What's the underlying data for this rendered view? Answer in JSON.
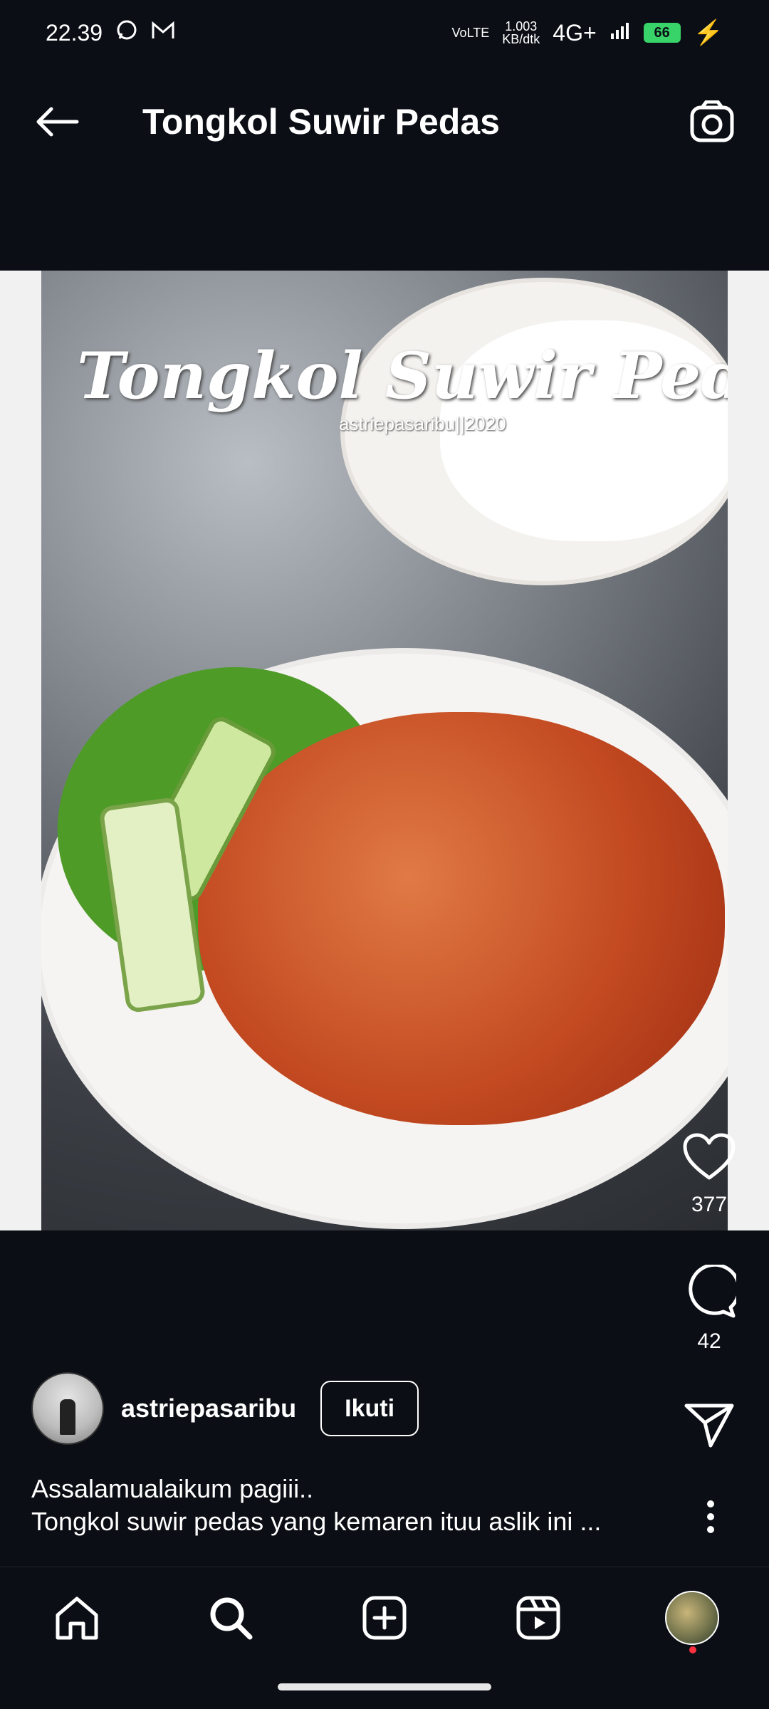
{
  "status_bar": {
    "time": "22.39",
    "network_type": "VoLTE",
    "speed_value": "1.003",
    "speed_unit": "KB/dtk",
    "signal": "4G+",
    "battery": "66"
  },
  "header": {
    "title": "Tongkol Suwir Pedas"
  },
  "post": {
    "photo_overlay_title": "Tongkol Suwir Pedas",
    "photo_overlay_credit": "astriepasaribu||2020",
    "likes": "377",
    "comments": "42",
    "author": "astriepasaribu",
    "follow_label": "Ikuti",
    "caption_line1": "Assalamualaikum pagiii..",
    "caption_line2": "Tongkol suwir pedas yang kemaren ituu aslik ini ..."
  },
  "nav": {
    "items": [
      "home-icon",
      "search-icon",
      "create-icon",
      "reels-icon",
      "profile"
    ]
  },
  "colors": {
    "background": "#0b0f15",
    "notification_dot": "#ff3040",
    "battery": "#38d46a"
  }
}
